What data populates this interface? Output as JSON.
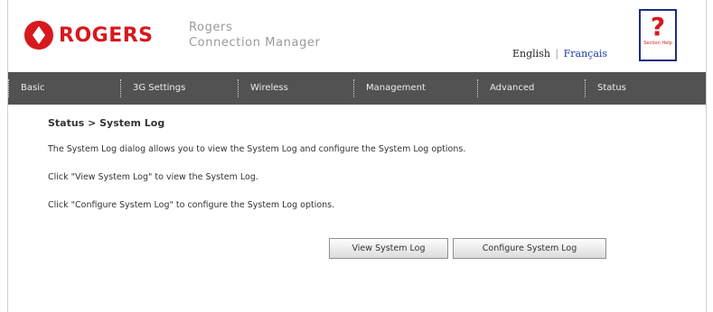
{
  "brand": {
    "logo_text": "ROGERS",
    "product_line1": "Rogers",
    "product_line2": "Connection Manager",
    "accent_color": "#d7191f"
  },
  "language": {
    "english": "English",
    "separator": "|",
    "french": "Français"
  },
  "help": {
    "glyph": "?",
    "label": "Section Help"
  },
  "nav": {
    "items": [
      {
        "label": "Basic"
      },
      {
        "label": "3G Settings"
      },
      {
        "label": "Wireless"
      },
      {
        "label": "Management"
      },
      {
        "label": "Advanced"
      },
      {
        "label": "Status"
      }
    ]
  },
  "page": {
    "breadcrumb": "Status > System Log",
    "paragraphs": [
      "The System Log dialog allows you to view the System Log and configure the System Log options.",
      "Click \"View System Log\" to view the System Log.",
      "Click \"Configure System Log\" to configure the System Log options."
    ]
  },
  "buttons": {
    "view_label": "View System Log",
    "configure_label": "Configure System Log"
  }
}
